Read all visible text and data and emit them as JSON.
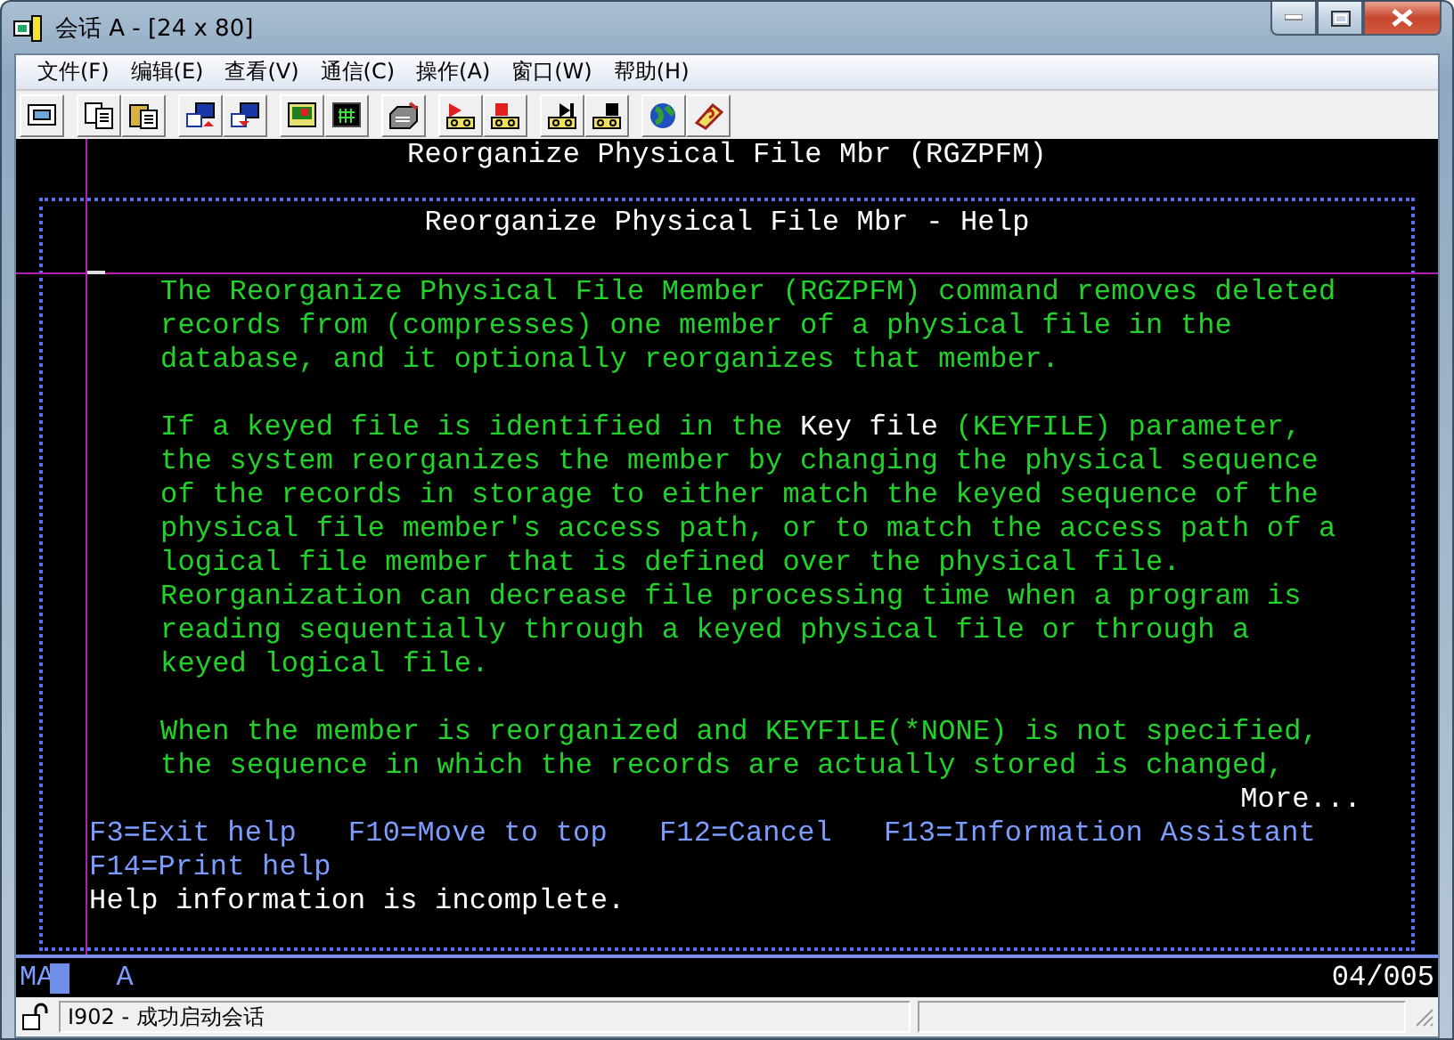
{
  "window": {
    "title": "会话 A - [24 x 80]"
  },
  "menu": [
    "文件(F)",
    "编辑(E)",
    "查看(V)",
    "通信(C)",
    "操作(A)",
    "窗口(W)",
    "帮助(H)"
  ],
  "toolbar_groups": [
    [
      {
        "kind": "screen"
      }
    ],
    [
      {
        "kind": "copy"
      },
      {
        "kind": "paste"
      }
    ],
    [
      {
        "kind": "send"
      },
      {
        "kind": "receive"
      }
    ],
    [
      {
        "kind": "display"
      },
      {
        "kind": "grid"
      }
    ],
    [
      {
        "kind": "keyboard"
      }
    ],
    [
      {
        "kind": "record"
      },
      {
        "kind": "stop"
      }
    ],
    [
      {
        "kind": "play"
      },
      {
        "kind": "pause"
      }
    ],
    [
      {
        "kind": "globe"
      },
      {
        "kind": "help"
      }
    ]
  ],
  "terminal": {
    "screen_title": "Reorganize Physical File Mbr (RGZPFM)",
    "help_title": "Reorganize Physical File Mbr - Help",
    "lines": [
      {
        "kind": "body",
        "segments": [
          {
            "text": "The Reorganize Physical File Member (RGZPFM) command removes deleted",
            "highlight": false
          }
        ]
      },
      {
        "kind": "body",
        "segments": [
          {
            "text": "records from (compresses) one member of a physical file in the",
            "highlight": false
          }
        ]
      },
      {
        "kind": "body",
        "segments": [
          {
            "text": "database, and it optionally reorganizes that member.",
            "highlight": false
          }
        ]
      },
      {
        "kind": "blank"
      },
      {
        "kind": "body",
        "segments": [
          {
            "text": "If a keyed file is identified in the ",
            "highlight": false
          },
          {
            "text": "Key file",
            "highlight": true
          },
          {
            "text": " (KEYFILE) parameter,",
            "highlight": false
          }
        ]
      },
      {
        "kind": "body",
        "segments": [
          {
            "text": "the system reorganizes the member by changing the physical sequence",
            "highlight": false
          }
        ]
      },
      {
        "kind": "body",
        "segments": [
          {
            "text": "of the records in storage to either match the keyed sequence of the",
            "highlight": false
          }
        ]
      },
      {
        "kind": "body",
        "segments": [
          {
            "text": "physical file member's access path, or to match the access path of a",
            "highlight": false
          }
        ]
      },
      {
        "kind": "body",
        "segments": [
          {
            "text": "logical file member that is defined over the physical file.",
            "highlight": false
          }
        ]
      },
      {
        "kind": "body",
        "segments": [
          {
            "text": "Reorganization can decrease file processing time when a program is",
            "highlight": false
          }
        ]
      },
      {
        "kind": "body",
        "segments": [
          {
            "text": "reading sequentially through a keyed physical file or through a",
            "highlight": false
          }
        ]
      },
      {
        "kind": "body",
        "segments": [
          {
            "text": "keyed logical file.",
            "highlight": false
          }
        ]
      },
      {
        "kind": "blank"
      },
      {
        "kind": "body",
        "segments": [
          {
            "text": "When the member is reorganized and KEYFILE(*NONE) is not specified,",
            "highlight": false
          }
        ]
      },
      {
        "kind": "body",
        "segments": [
          {
            "text": "the sequence in which the records are actually stored is changed,",
            "highlight": false
          }
        ]
      }
    ],
    "more": "More...",
    "function_keys": [
      [
        "F3=Exit help",
        "F10=Move to top",
        "F12=Cancel",
        "F13=Information Assistant"
      ],
      [
        "F14=Print help"
      ]
    ],
    "message": "Help information is incomplete.",
    "status": {
      "mode": "MA",
      "field": "A",
      "position": "04/005"
    }
  },
  "status_bar": {
    "message": "I902 - 成功启动会话"
  }
}
